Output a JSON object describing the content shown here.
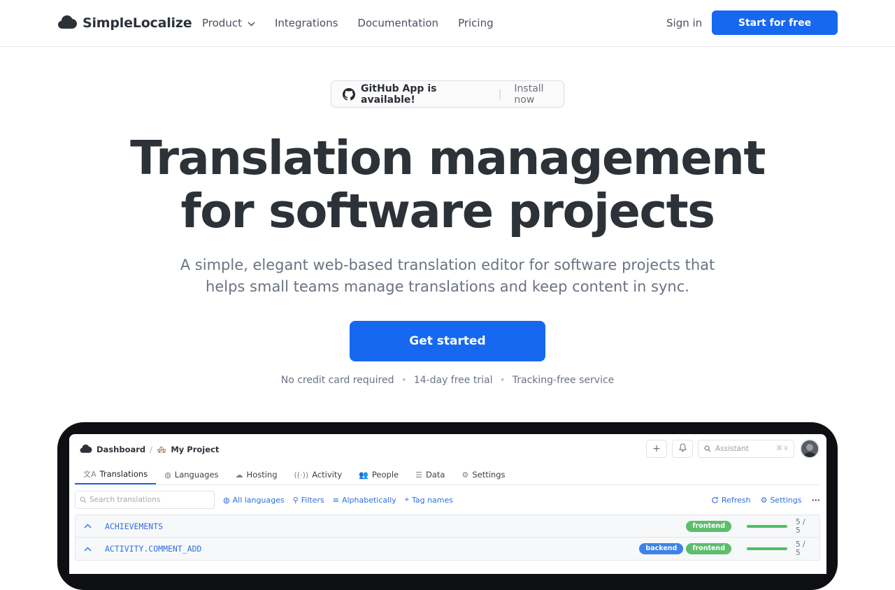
{
  "header": {
    "logo_text": "SimpleLocalize",
    "nav": [
      "Product",
      "Integrations",
      "Documentation",
      "Pricing"
    ],
    "sign_in": "Sign in",
    "start_free": "Start for free"
  },
  "hero": {
    "pill_title": "GitHub App is available!",
    "pill_sep": "|",
    "pill_action": "Install now",
    "title_line1": "Translation management",
    "title_line2": "for software projects",
    "subtitle_line1": "A simple, elegant web-based translation editor for software projects that",
    "subtitle_line2": "helps small teams manage translations and keep content in sync.",
    "cta": "Get started",
    "perks": [
      "No credit card required",
      "14-day free trial",
      "Tracking-free service"
    ],
    "perk_sep": "•"
  },
  "app": {
    "crumb_dashboard": "Dashboard",
    "crumb_sep": "/",
    "crumb_project_emoji": "🏘️",
    "crumb_project": "My Project",
    "plus": "+",
    "search_placeholder": "Assistant",
    "search_kbd": "⌘ k",
    "tabs": [
      "Translations",
      "Languages",
      "Hosting",
      "Activity",
      "People",
      "Data",
      "Settings"
    ],
    "tab_icons": [
      "文A",
      "◍",
      "☁",
      "((·))",
      "👥",
      "☰",
      "⚙"
    ],
    "search_translations": "Search translations",
    "toolbar_links": [
      "All languages",
      "Filters",
      "Alphabetically",
      "Tag names"
    ],
    "toolbar_icons": [
      "◍",
      "⚲",
      "≡",
      "⌖"
    ],
    "refresh": "Refresh",
    "settings": "Settings",
    "more": "···",
    "rows": [
      {
        "key": "ACHIEVEMENTS",
        "tags": [
          "frontend"
        ],
        "count": "5 / 5"
      },
      {
        "key": "ACTIVITY.COMMENT_ADD",
        "tags": [
          "backend",
          "frontend"
        ],
        "count": "5 / 5"
      }
    ],
    "progress": [
      1.0,
      1.0
    ]
  },
  "colors": {
    "accent": "#1668f0",
    "frontend_tag": "#5cbd6d",
    "backend_tag": "#3c82ea"
  }
}
